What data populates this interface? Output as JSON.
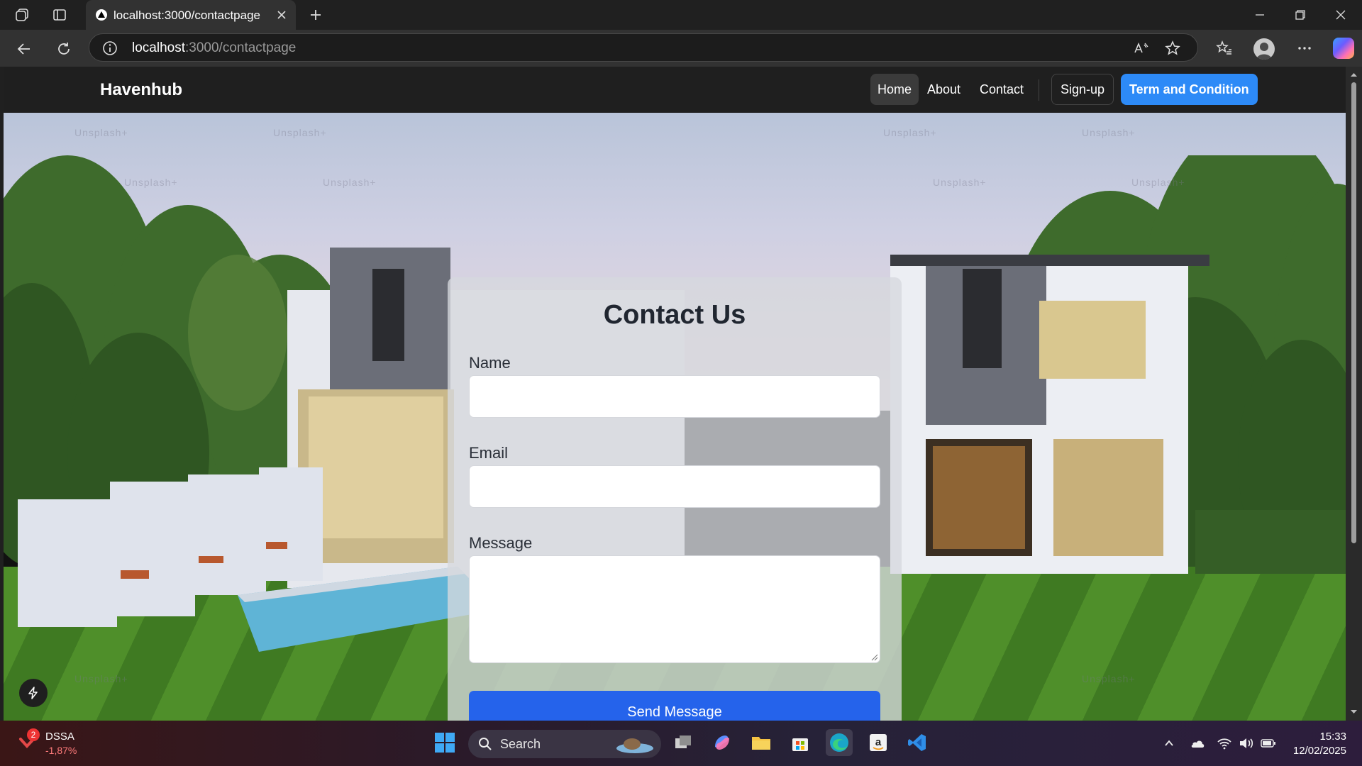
{
  "browser": {
    "tab_title": "localhost:3000/contactpage",
    "url_host": "localhost",
    "url_rest": ":3000/contactpage"
  },
  "site": {
    "brand": "Havenhub",
    "nav": [
      {
        "label": "Home",
        "active": true
      },
      {
        "label": "About",
        "active": false
      },
      {
        "label": "Contact",
        "active": false
      }
    ],
    "signup_label": "Sign-up",
    "terms_label": "Term and Condition",
    "accent_color": "#2d8af7"
  },
  "contact_form": {
    "title": "Contact Us",
    "name_label": "Name",
    "name_value": "",
    "email_label": "Email",
    "email_value": "",
    "message_label": "Message",
    "message_value": "",
    "submit_label": "Send Message",
    "submit_color": "#2563eb"
  },
  "hero": {
    "watermark": "Unsplash+"
  },
  "taskbar": {
    "stock_symbol": "DSSA",
    "stock_change": "-1,87%",
    "stock_badge": "2",
    "search_label": "Search",
    "time": "15:33",
    "date": "12/02/2025"
  }
}
